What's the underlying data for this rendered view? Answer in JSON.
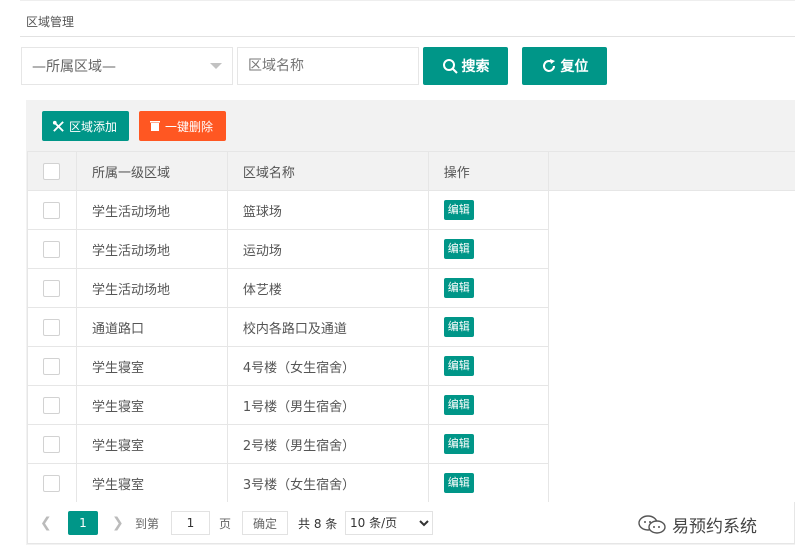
{
  "page": {
    "title": "区域管理"
  },
  "search": {
    "region_select_value": "—所属区域—",
    "name_placeholder": "区域名称",
    "search_label": "搜索",
    "reset_label": "复位"
  },
  "toolbar": {
    "add_label": "区域添加",
    "delete_label": "一键删除"
  },
  "table": {
    "headers": {
      "region": "所属一级区域",
      "name": "区域名称",
      "ops": "操作"
    },
    "edit_label": "编辑",
    "rows": [
      {
        "region": "学生活动场地",
        "name": "篮球场"
      },
      {
        "region": "学生活动场地",
        "name": "运动场"
      },
      {
        "region": "学生活动场地",
        "name": "体艺楼"
      },
      {
        "region": "通道路口",
        "name": "校内各路口及通道"
      },
      {
        "region": "学生寝室",
        "name": "4号楼（女生宿舍）"
      },
      {
        "region": "学生寝室",
        "name": "1号楼（男生宿舍）"
      },
      {
        "region": "学生寝室",
        "name": "2号楼（男生宿舍）"
      },
      {
        "region": "学生寝室",
        "name": "3号楼（女生宿舍）"
      }
    ]
  },
  "pager": {
    "current_page": "1",
    "goto_label": "到第",
    "goto_value": "1",
    "page_label": "页",
    "confirm_label": "确定",
    "total_label": "共 8 条",
    "page_size": "10 条/页"
  },
  "watermark": {
    "text": "易预约系统"
  },
  "colors": {
    "primary": "#009688",
    "danger": "#ff5722"
  }
}
